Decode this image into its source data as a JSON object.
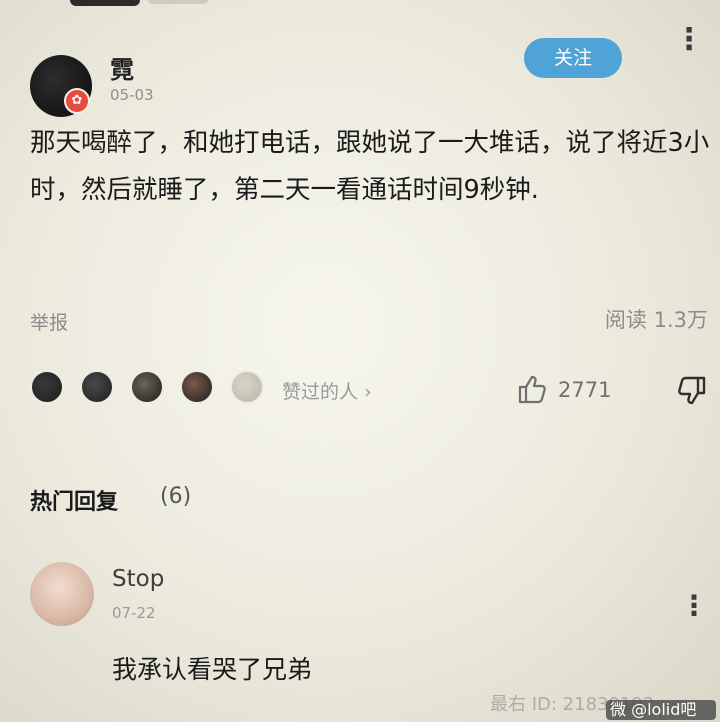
{
  "post": {
    "username": "霓",
    "date": "05-03",
    "follow_label": "关注",
    "more_icon": "⋮",
    "body": "那天喝醉了，和她打电话，跟她说了一大堆话，说了将近3小时，然后就睡了，第二天一看通话时间9秒钟.",
    "report_label": "举报",
    "read_count": "阅读 1.3万"
  },
  "engagement": {
    "liked_by_label": "赞过的人 ›",
    "like_count": "2771",
    "liker_colors": [
      "#3a3a3a",
      "#4a4a4a",
      "#6a6458",
      "#7a5a4a",
      "#b8b6a8"
    ]
  },
  "replies": {
    "title": "热门回复",
    "count": "(6)",
    "items": [
      {
        "username": "Stop",
        "date": "07-22",
        "body": "我承认看哭了兄弟",
        "more_icon": "⋮"
      }
    ]
  },
  "watermark": {
    "text": "最右 ID: 21830192",
    "tag": "微 @lolid吧"
  },
  "colors": {
    "accent": "#4fa3d6",
    "badge": "#e84a3f"
  }
}
